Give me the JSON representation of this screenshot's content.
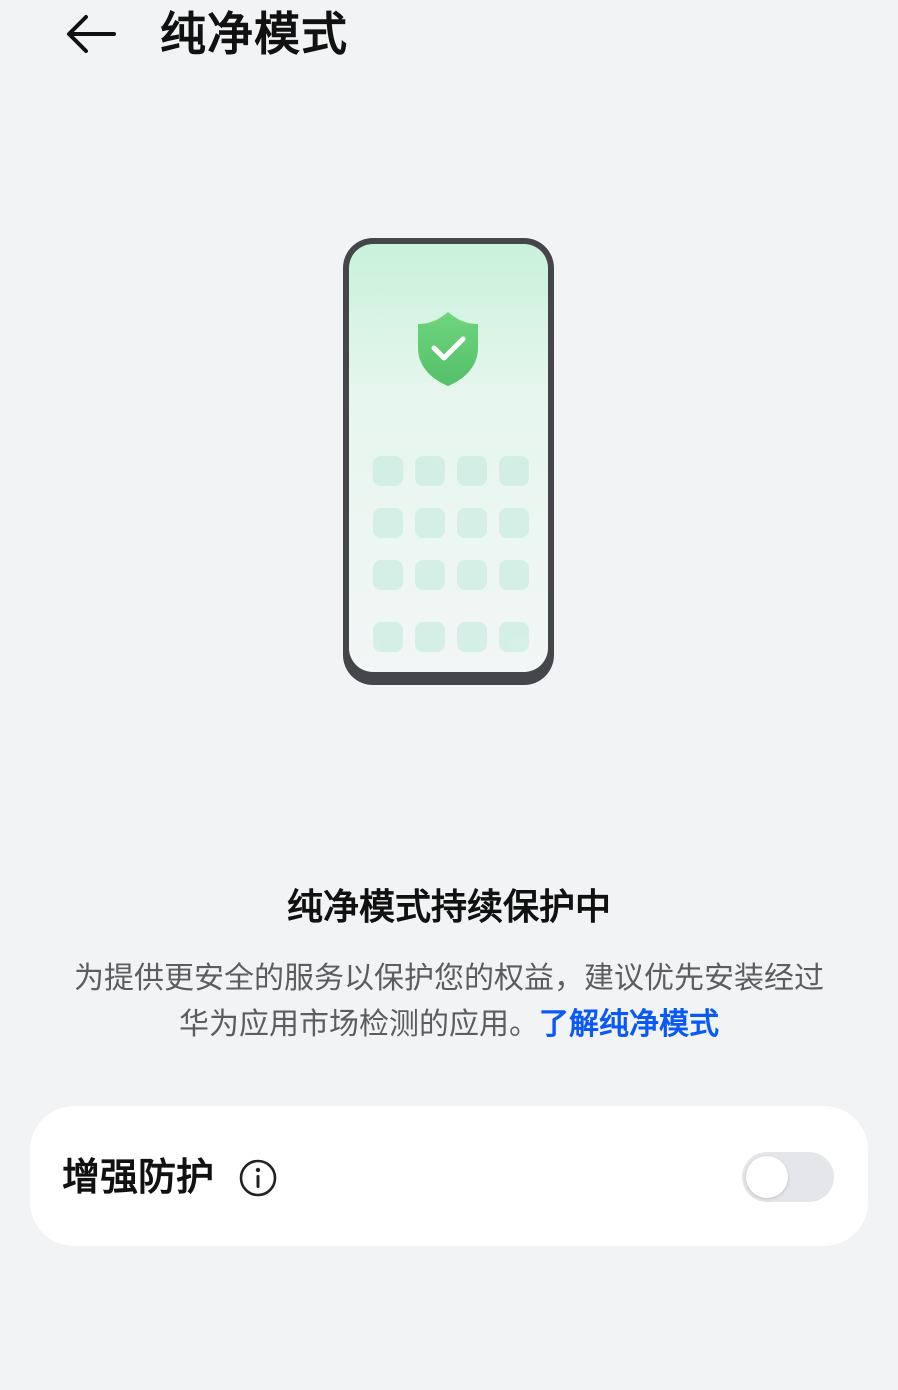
{
  "header": {
    "title": "纯净模式"
  },
  "status": {
    "title": "纯净模式持续保护中",
    "description": "为提供更安全的服务以保护您的权益，建议优先安装经过华为应用市场检测的应用。",
    "learn_more_link": "了解纯净模式"
  },
  "settings": {
    "enhanced_protection_label": "增强防护",
    "enhanced_protection_enabled": false
  },
  "colors": {
    "background": "#F1F3F5",
    "link": "#0A59F7",
    "shield": "#5CCB6E",
    "phone_frame": "#45464a"
  }
}
